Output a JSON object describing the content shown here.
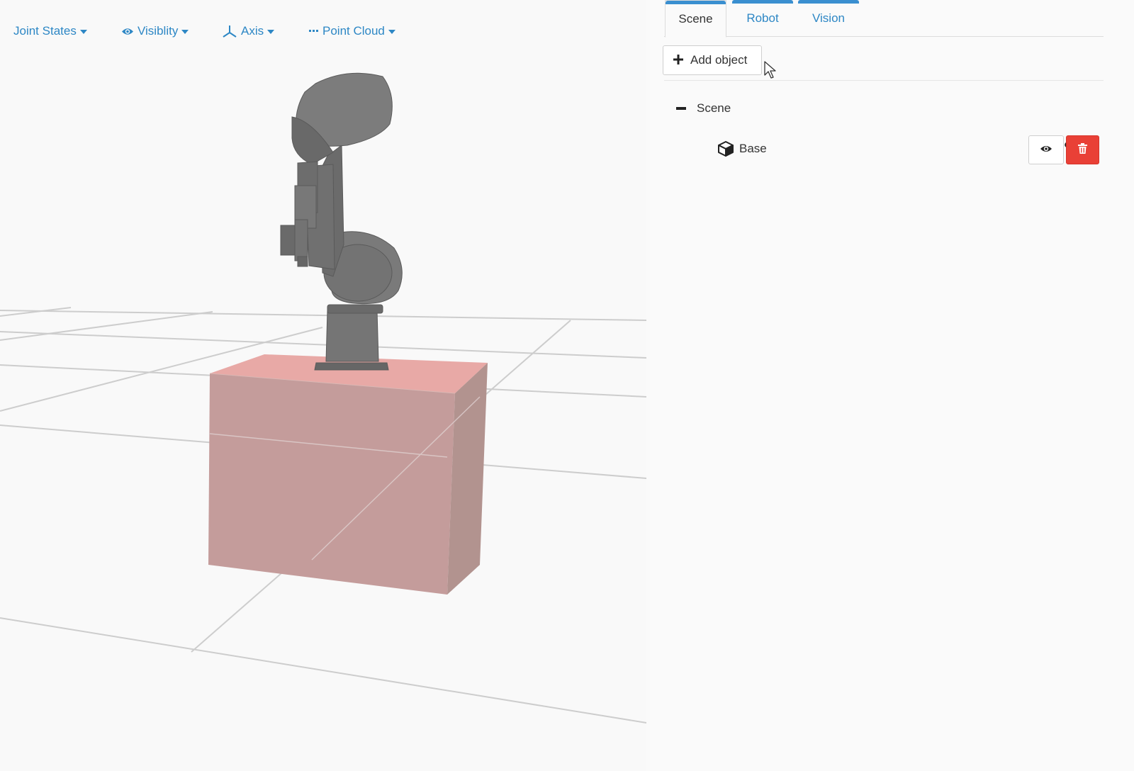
{
  "toolbar": {
    "joint_states": "Joint States",
    "visibility": "Visiblity",
    "axis": "Axis",
    "point_cloud": "Point Cloud"
  },
  "tabs": [
    {
      "label": "Scene",
      "active": true
    },
    {
      "label": "Robot",
      "active": false
    },
    {
      "label": "Vision",
      "active": false
    }
  ],
  "panel": {
    "add_object_label": "Add object",
    "tree_root_label": "Scene",
    "tree_item_label": "Base"
  },
  "colors": {
    "accent": "#2d87c5",
    "tab_bar": "#3a8fd0",
    "delete": "#e94036",
    "box_front": "#c49c9b",
    "box_top": "#e8a9a6",
    "box_side": "#b2938f",
    "robot": "#6f6f6f"
  },
  "icons": {
    "visibility": "eye-icon",
    "axis": "axis-icon",
    "point_cloud": "dots-icon",
    "add": "plus-icon",
    "collapse": "minus-icon",
    "object": "cube-icon",
    "link": "link-icon",
    "toggle_visibility": "eye-icon",
    "delete": "trash-icon"
  }
}
